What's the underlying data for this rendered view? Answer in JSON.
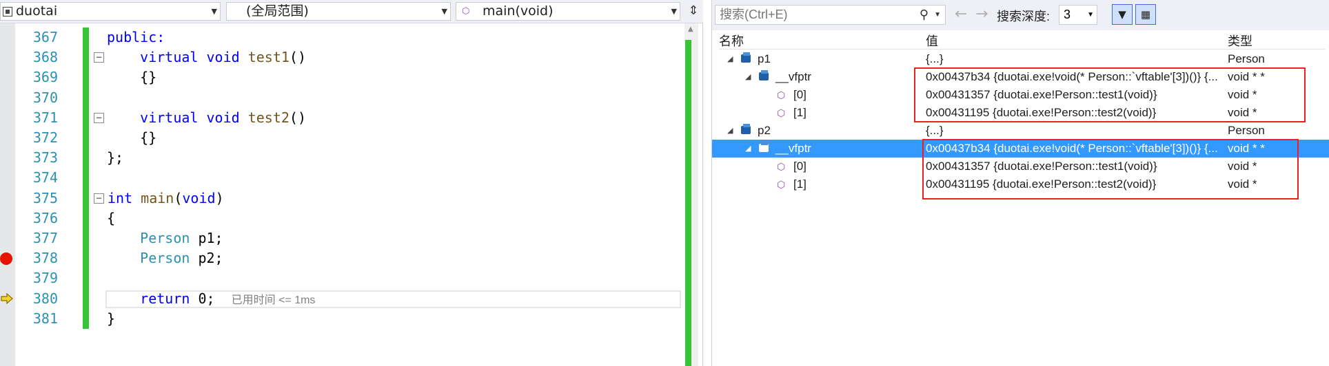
{
  "nav": {
    "project": "duotai",
    "scope": "(全局范围)",
    "function": "main(void)"
  },
  "editor": {
    "lines": [
      {
        "n": "367",
        "parts": [
          {
            "t": "public:",
            "c": "kw"
          }
        ]
      },
      {
        "n": "368",
        "parts": [
          {
            "t": "    virtual void ",
            "c": "kw"
          },
          {
            "t": "test1",
            "c": "fn"
          },
          {
            "t": "()",
            "c": "pl"
          }
        ]
      },
      {
        "n": "369",
        "parts": [
          {
            "t": "    {}",
            "c": "pl"
          }
        ]
      },
      {
        "n": "370",
        "parts": []
      },
      {
        "n": "371",
        "parts": [
          {
            "t": "    virtual void ",
            "c": "kw"
          },
          {
            "t": "test2",
            "c": "fn"
          },
          {
            "t": "()",
            "c": "pl"
          }
        ]
      },
      {
        "n": "372",
        "parts": [
          {
            "t": "    {}",
            "c": "pl"
          }
        ]
      },
      {
        "n": "373",
        "parts": [
          {
            "t": "};",
            "c": "pl"
          }
        ]
      },
      {
        "n": "374",
        "parts": []
      },
      {
        "n": "375",
        "parts": [
          {
            "t": "int ",
            "c": "kw"
          },
          {
            "t": "main",
            "c": "fn"
          },
          {
            "t": "(",
            "c": "pl"
          },
          {
            "t": "void",
            "c": "kw"
          },
          {
            "t": ")",
            "c": "pl"
          }
        ]
      },
      {
        "n": "376",
        "parts": [
          {
            "t": "{",
            "c": "pl"
          }
        ]
      },
      {
        "n": "377",
        "parts": [
          {
            "t": "    Person ",
            "c": "ty"
          },
          {
            "t": "p1;",
            "c": "pl"
          }
        ]
      },
      {
        "n": "378",
        "parts": [
          {
            "t": "    Person ",
            "c": "ty"
          },
          {
            "t": "p2;",
            "c": "pl"
          }
        ]
      },
      {
        "n": "379",
        "parts": []
      },
      {
        "n": "380",
        "parts": [
          {
            "t": "    return ",
            "c": "kw"
          },
          {
            "t": "0;  ",
            "c": "pl"
          },
          {
            "t": "已用时间 <= 1ms",
            "c": "gray"
          }
        ]
      },
      {
        "n": "381",
        "parts": [
          {
            "t": "}",
            "c": "pl"
          }
        ]
      }
    ]
  },
  "watch": {
    "search_placeholder": "搜索(Ctrl+E)",
    "depth_label": "搜索深度:",
    "depth_value": "3",
    "columns": {
      "name": "名称",
      "value": "值",
      "type": "类型"
    },
    "rows": [
      {
        "name": "p1",
        "value": "{...}",
        "type": "Person",
        "kind": "object",
        "level": 0,
        "expander": "◢"
      },
      {
        "name": "__vfptr",
        "value": "0x00437b34 {duotai.exe!void(* Person::`vftable'[3])()} {...",
        "type": "void * *",
        "kind": "object",
        "level": 1,
        "expander": "◢"
      },
      {
        "name": "[0]",
        "value": "0x00431357 {duotai.exe!Person::test1(void)}",
        "type": "void *",
        "kind": "member",
        "level": 2,
        "expander": ""
      },
      {
        "name": "[1]",
        "value": "0x00431195 {duotai.exe!Person::test2(void)}",
        "type": "void *",
        "kind": "member",
        "level": 2,
        "expander": ""
      },
      {
        "name": "p2",
        "value": "{...}",
        "type": "Person",
        "kind": "object",
        "level": 0,
        "expander": "◢"
      },
      {
        "name": "__vfptr",
        "value": "0x00437b34 {duotai.exe!void(* Person::`vftable'[3])()} {...",
        "type": "void * *",
        "kind": "object",
        "level": 1,
        "expander": "◢",
        "selected": true
      },
      {
        "name": "[0]",
        "value": "0x00431357 {duotai.exe!Person::test1(void)}",
        "type": "void *",
        "kind": "member",
        "level": 2,
        "expander": ""
      },
      {
        "name": "[1]",
        "value": "0x00431195 {duotai.exe!Person::test2(void)}",
        "type": "void *",
        "kind": "member",
        "level": 2,
        "expander": ""
      }
    ]
  }
}
